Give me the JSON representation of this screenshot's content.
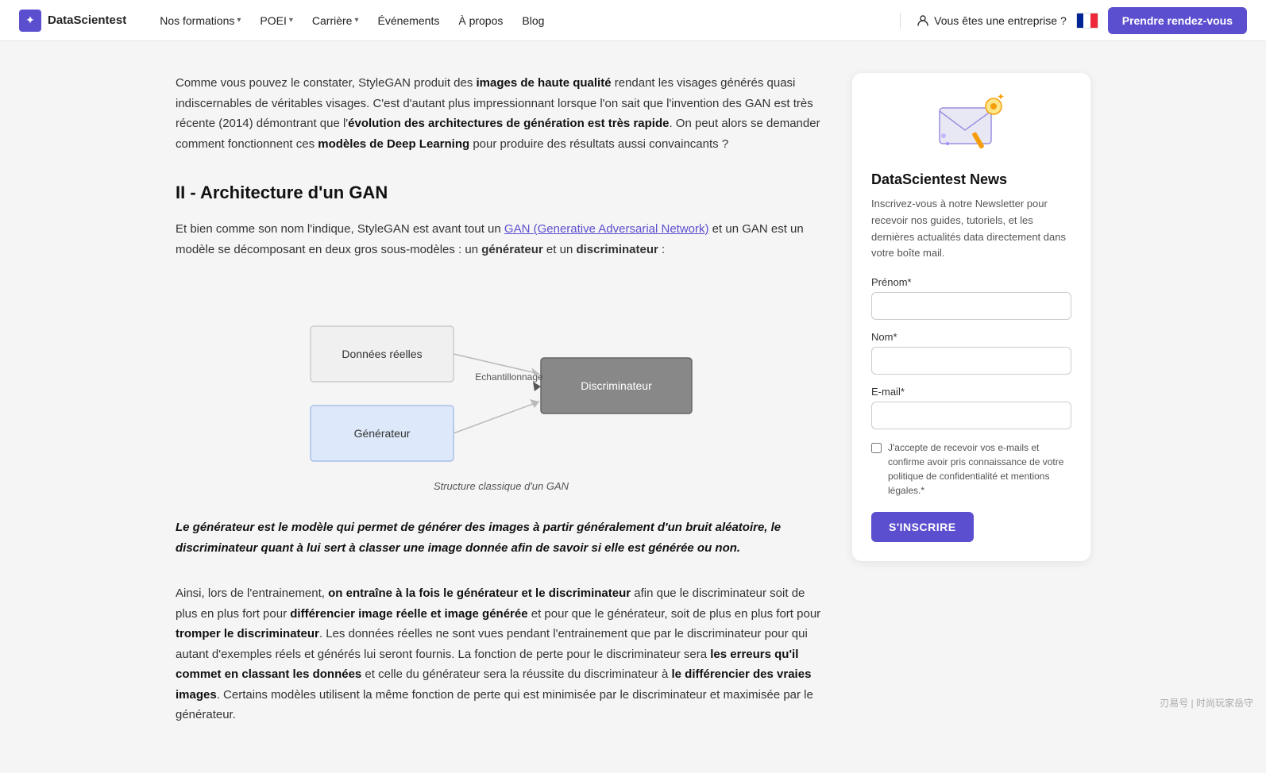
{
  "navbar": {
    "logo_text": "DataScientest",
    "logo_icon": "✦",
    "links": [
      {
        "label": "Nos formations",
        "has_dropdown": true
      },
      {
        "label": "POEI",
        "has_dropdown": true
      },
      {
        "label": "Carrière",
        "has_dropdown": true
      },
      {
        "label": "Événements",
        "has_dropdown": false
      },
      {
        "label": "À propos",
        "has_dropdown": false
      },
      {
        "label": "Blog",
        "has_dropdown": false
      }
    ],
    "enterprise_label": "Vous êtes une entreprise ?",
    "cta_label": "Prendre rendez-vous"
  },
  "main": {
    "intro": {
      "text_before_bold1": "Comme vous pouvez le constater, StyleGAN produit des ",
      "bold1": "images de haute qualité",
      "text_after_bold1": " rendant les visages générés quasi indiscernables de véritables visages. C'est d'autant plus impressionnant lorsque l'on sait que l'invention des GAN est très récente (2014) démontrant que l'",
      "bold2": "évolution des architectures de génération est très rapide",
      "text_after_bold2": ". On peut alors se demander comment fonctionnent ces ",
      "bold3": "modèles de Deep Learning",
      "text_end": " pour produire des résultats aussi convaincants ?"
    },
    "section_heading": "II - Architecture d'un GAN",
    "section_intro": {
      "text1": "Et bien comme son nom l'indique, StyleGAN est avant tout un ",
      "link_text": "GAN (Generative Adversarial Network)",
      "text2": " et un GAN est un modèle se décomposant en deux gros sous-modèles : un ",
      "bold1": "générateur",
      "text3": " et un ",
      "bold2": "discriminateur",
      "text4": " :"
    },
    "diagram": {
      "caption": "Structure classique d'un GAN",
      "node_reelles": "Données réelles",
      "node_generateur": "Générateur",
      "node_echantillonnage": "Echantillonnage",
      "node_discriminateur": "Discriminateur"
    },
    "blockquote": "Le générateur est le modèle qui permet de générer des images à partir généralement d'un bruit aléatoire, le discriminateur quant à lui sert à classer une image donnée afin de savoir si elle est générée ou non.",
    "bottom_text": {
      "text1": "Ainsi, lors de l'entrainement, ",
      "bold1": "on entraîne à la fois le générateur et le discriminateur",
      "text2": " afin que le discriminateur soit de plus en plus fort pour ",
      "bold2": "différencier image réelle et image générée",
      "text3": " et pour que le générateur, soit de plus en plus fort pour ",
      "bold3": "tromper le discriminateur",
      "text4": ". Les données réelles ne sont vues pendant l'entrainement que par le discriminateur pour qui autant d'exemples réels et générés lui seront fournis. La fonction de perte pour le discriminateur sera ",
      "bold4": "les erreurs qu'il commet en classant les données",
      "text5": " et celle du générateur sera la réussite du discriminateur à ",
      "bold5": "le différencier des vraies images",
      "text6": ". Certains modèles utilisent la même fonction de perte qui est minimisée par le discriminateur et maximisée par le générateur."
    }
  },
  "sidebar": {
    "title": "DataScientest News",
    "description": "Inscrivez-vous à notre Newsletter pour recevoir nos guides, tutoriels, et les dernières actualités data directement dans votre boîte mail.",
    "form": {
      "prenom_label": "Prénom*",
      "prenom_placeholder": "",
      "nom_label": "Nom*",
      "nom_placeholder": "",
      "email_label": "E-mail*",
      "email_placeholder": "",
      "checkbox_label": "J'accepte de recevoir vos e-mails et confirme avoir pris connaissance de votre politique de confidentialité et mentions légales.*",
      "submit_label": "S'INSCRIRE"
    }
  },
  "watermark": "刃易号 | 时尚玩家岳守"
}
